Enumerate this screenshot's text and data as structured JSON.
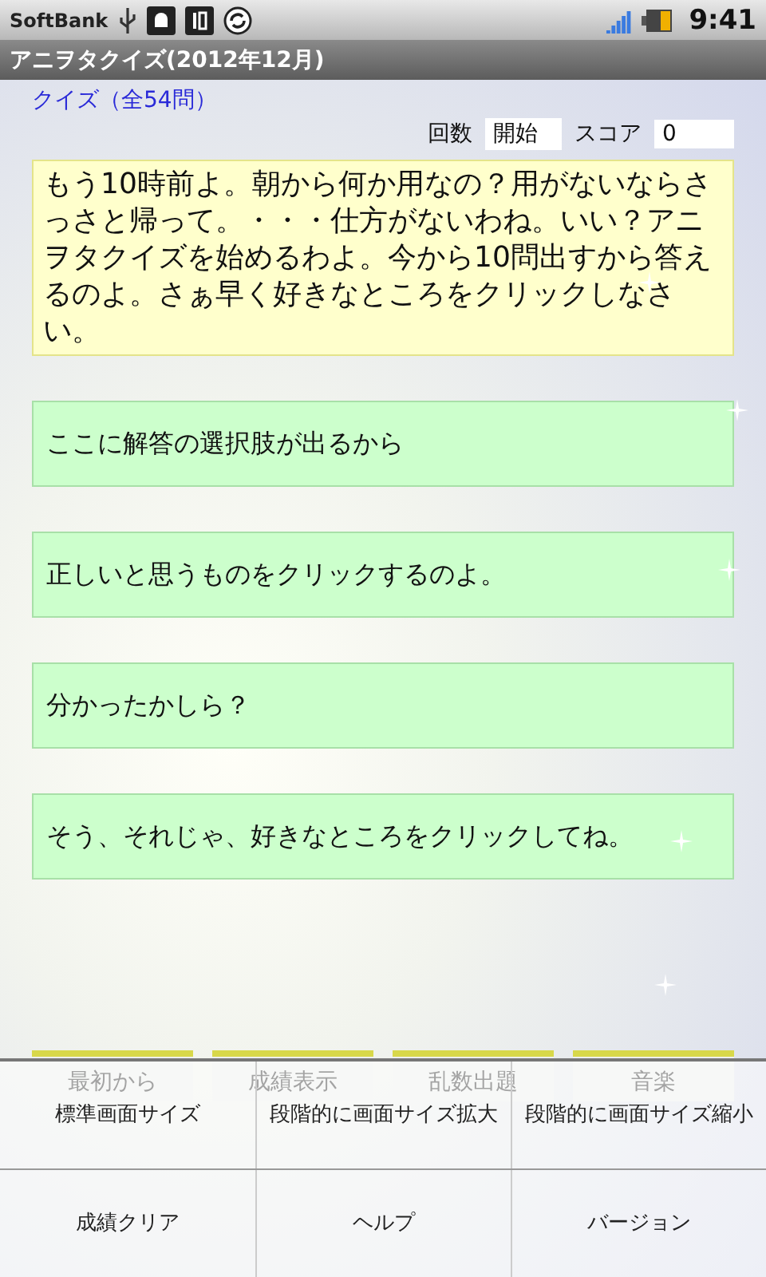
{
  "status_bar": {
    "carrier": "SoftBank",
    "time": "9:41"
  },
  "title_bar": {
    "title": "アニヲタクイズ(2012年12月)"
  },
  "quiz_label": "クイズ（全54問）",
  "counters": [
    {
      "label": "回数",
      "value": "開始"
    },
    {
      "label": "スコア",
      "value": "0"
    }
  ],
  "message": "もう10時前よ。朝から何か用なの？用がないならさっさと帰って。・・・仕方がないわね。いい？アニヲタクイズを始めるわよ。今から10問出すから答えるのよ。さぁ早く好きなところをクリックしなさい。",
  "answers": [
    "ここに解答の選択肢が出るから",
    "正しいと思うものをクリックするのよ。",
    "分かったかしら？",
    "そう、それじゃ、好きなところをクリックしてね。"
  ],
  "bottom_buttons": [
    "最初から",
    "成績表示",
    "乱数出題",
    "音楽"
  ],
  "options_menu": [
    [
      "標準画面サイズ",
      "段階的に画面サイズ拡大",
      "段階的に画面サイズ縮小"
    ],
    [
      "成績クリア",
      "ヘルプ",
      "バージョン"
    ]
  ]
}
